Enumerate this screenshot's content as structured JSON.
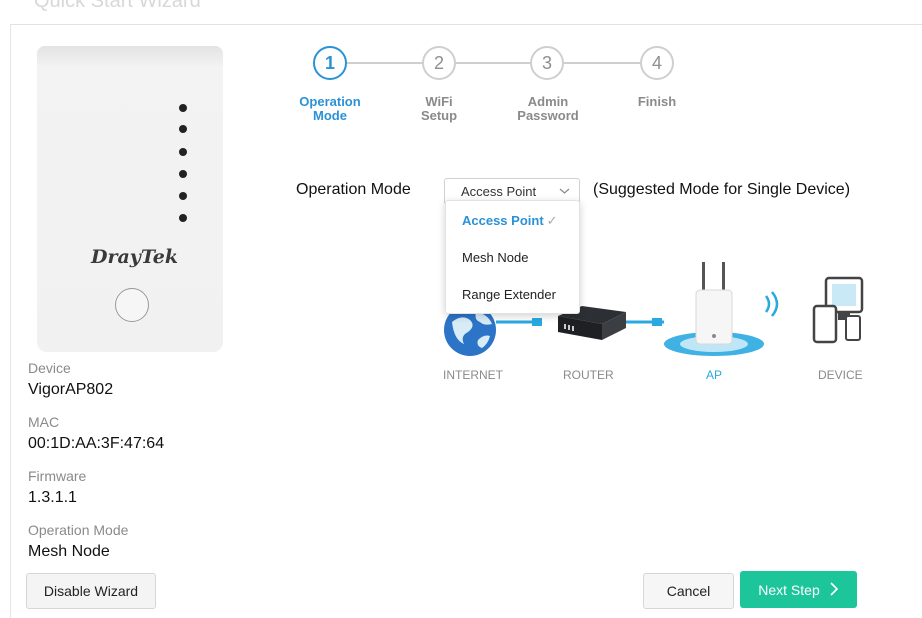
{
  "header": {
    "title": "Quick Start Wizard"
  },
  "device": {
    "brand": "DrayTek",
    "device_label": "Device",
    "device_value": "VigorAP802",
    "mac_label": "MAC",
    "mac_value": "00:1D:AA:3F:47:64",
    "firmware_label": "Firmware",
    "firmware_value": "1.3.1.1",
    "opmode_label": "Operation Mode",
    "opmode_value": "Mesh Node"
  },
  "steps": [
    {
      "number": "1",
      "label1": "Operation",
      "label2": "Mode",
      "active": true
    },
    {
      "number": "2",
      "label1": "WiFi",
      "label2": "Setup",
      "active": false
    },
    {
      "number": "3",
      "label1": "Admin",
      "label2": "Password",
      "active": false
    },
    {
      "number": "4",
      "label1": "Finish",
      "label2": "",
      "active": false
    }
  ],
  "operation": {
    "label": "Operation Mode",
    "selected": "Access Point",
    "suggestion": "(Suggested Mode for Single Device)",
    "options": [
      "Access Point",
      "Mesh Node",
      "Range Extender"
    ]
  },
  "diagram": {
    "internet": "INTERNET",
    "router": "ROUTER",
    "ap": "AP",
    "device": "DEVICE"
  },
  "footer": {
    "disable_label": "Disable Wizard",
    "cancel_label": "Cancel",
    "next_label": "Next Step"
  },
  "colors": {
    "accent": "#2a92d6",
    "primary_button": "#1dc59a",
    "ap_glow": "#2aa8e0"
  }
}
